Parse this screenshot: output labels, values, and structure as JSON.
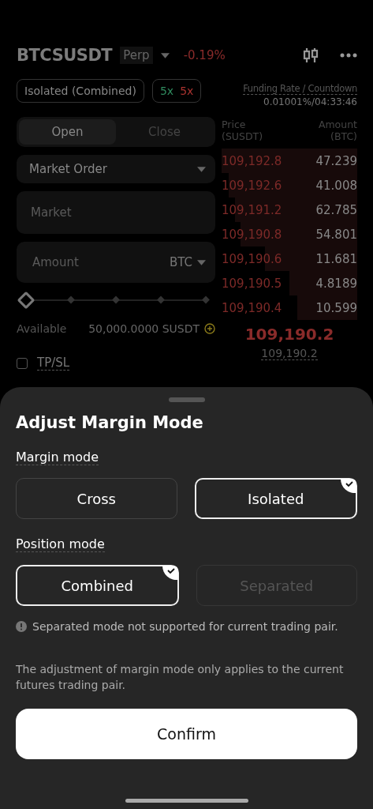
{
  "header": {
    "symbol": "BTCSUSDT",
    "type_badge": "Perp",
    "change": "-0.19%"
  },
  "margin_tag": "Isolated (Combined)",
  "leverage": [
    {
      "value": "5x",
      "color": "#2f8a5e"
    },
    {
      "value": "5x",
      "color": "#a8322f"
    }
  ],
  "funding": {
    "label": "Funding Rate / Countdown",
    "value": "0.01001%/04:33:46"
  },
  "tabs": [
    {
      "label": "Open",
      "selected": true
    },
    {
      "label": "Close",
      "selected": false
    }
  ],
  "order_type": "Market Order",
  "price_field": {
    "placeholder": "Market"
  },
  "amount_field": {
    "placeholder": "Amount",
    "unit": "BTC"
  },
  "slider": {
    "level": 0
  },
  "available": {
    "label": "Available",
    "value": "50,000.0000 SUSDT"
  },
  "book": {
    "price_header": "Price\n(SUSDT)",
    "amount_header": "Amount\n(BTC)",
    "asks": [
      {
        "price": "109,192.8",
        "amount": "47.239"
      },
      {
        "price": "109,192.6",
        "amount": "41.008"
      },
      {
        "price": "109,191.2",
        "amount": "62.785"
      },
      {
        "price": "109,190.8",
        "amount": "54.801"
      },
      {
        "price": "109,190.6",
        "amount": "11.681"
      },
      {
        "price": "109,190.5",
        "amount": "4.8189"
      },
      {
        "price": "109,190.4",
        "amount": "10.599"
      }
    ],
    "last_price": "109,190.2",
    "mark_price": "109,190.2"
  },
  "tpsl": {
    "label": "TP/SL",
    "checked": false
  },
  "sheet": {
    "title": "Adjust Margin Mode",
    "sections": [
      {
        "label": "Margin mode",
        "options": [
          {
            "label": "Cross",
            "selected": false,
            "disabled": false
          },
          {
            "label": "Isolated",
            "selected": true,
            "disabled": false
          }
        ]
      },
      {
        "label": "Position mode",
        "options": [
          {
            "label": "Combined",
            "selected": true,
            "disabled": false
          },
          {
            "label": "Separated",
            "selected": false,
            "disabled": true
          }
        ]
      }
    ],
    "warning": "Separated mode not supported for current trading pair.",
    "note": "The adjustment of margin mode only applies to the current futures trading pair.",
    "confirm": "Confirm"
  }
}
